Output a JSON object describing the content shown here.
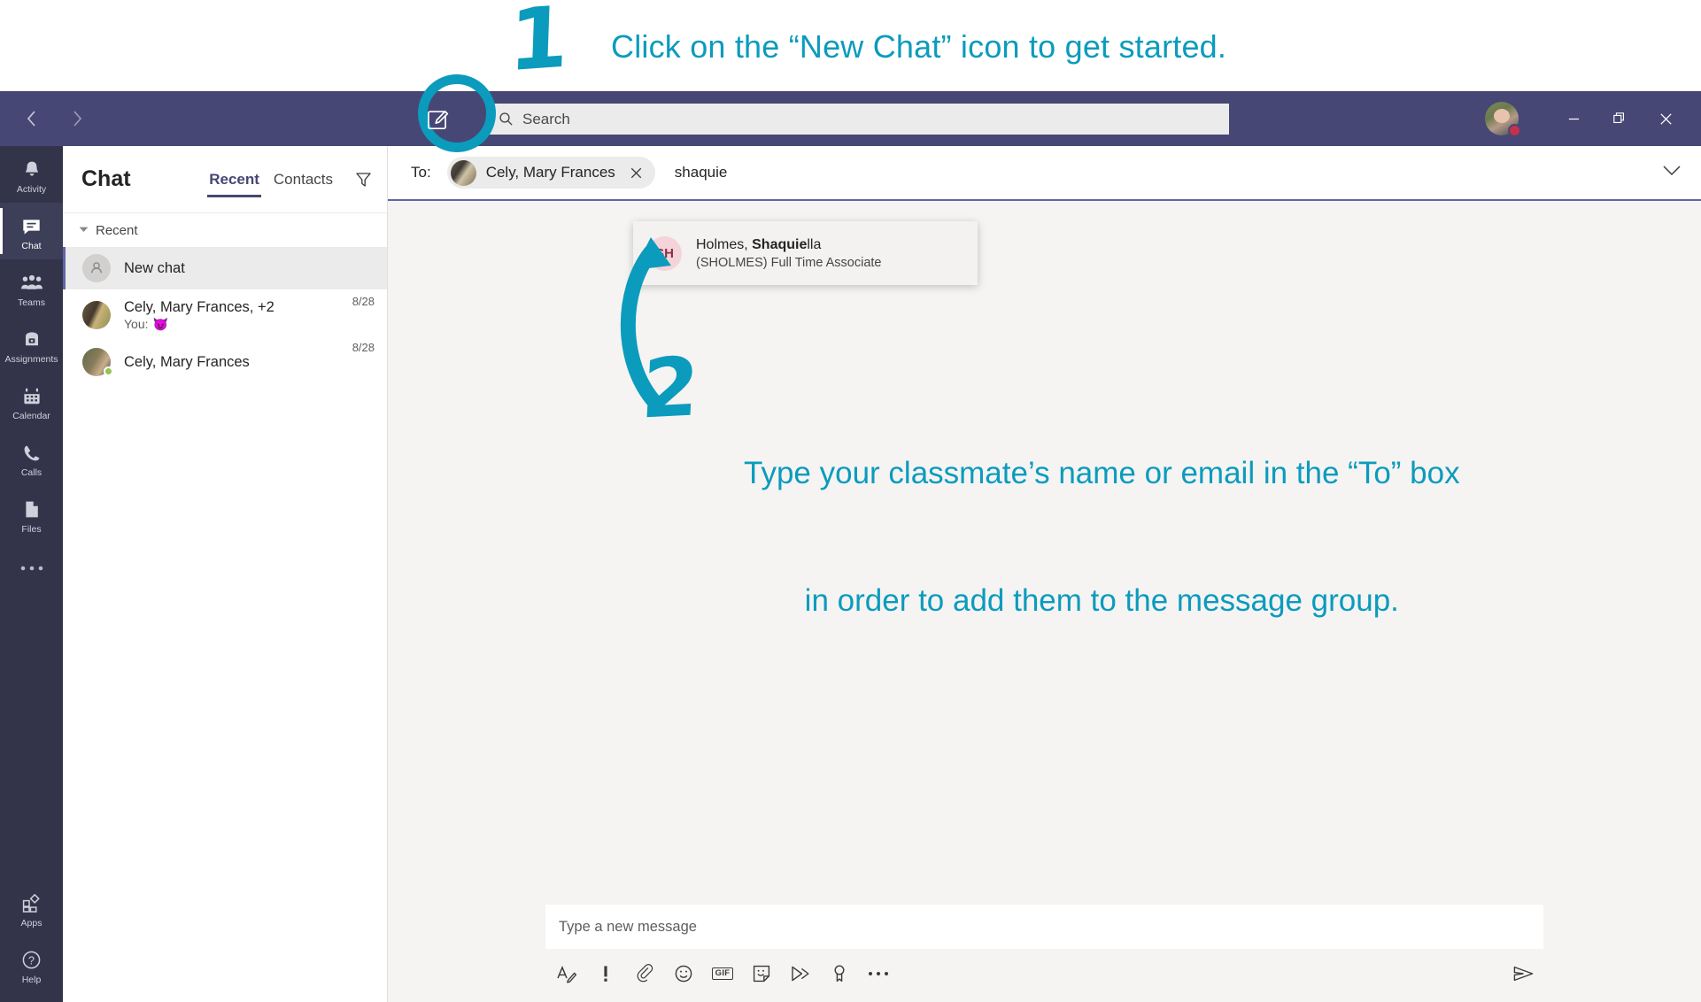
{
  "annotations": {
    "step1": {
      "numeral": "1",
      "text": "Click on the “New Chat” icon to get started."
    },
    "step2": {
      "numeral": "2",
      "line1": "Type your classmate’s name or email in the “To” box",
      "line2": "in order to add them to the message group."
    },
    "accent_color": "#0b9bbd"
  },
  "titlebar": {
    "back_icon": "chevron-left-icon",
    "forward_icon": "chevron-right-icon",
    "new_chat_icon": "compose-pencil-icon",
    "search_icon": "search-icon",
    "search_placeholder": "Search",
    "minimize_label": "—",
    "maximize_label": "❐",
    "close_label": "✕",
    "background_color": "#464775",
    "presence_color": "#c4314b"
  },
  "rail": {
    "items": [
      {
        "label": "Activity",
        "icon": "bell-icon",
        "active": false
      },
      {
        "label": "Chat",
        "icon": "chat-bubble-icon",
        "active": true
      },
      {
        "label": "Teams",
        "icon": "people-icon",
        "active": false
      },
      {
        "label": "Assignments",
        "icon": "backpack-icon",
        "active": false
      },
      {
        "label": "Calendar",
        "icon": "calendar-icon",
        "active": false
      },
      {
        "label": "Calls",
        "icon": "phone-icon",
        "active": false
      },
      {
        "label": "Files",
        "icon": "file-icon",
        "active": false
      },
      {
        "label": "",
        "icon": "more-dots-icon",
        "active": false
      }
    ],
    "bottom_items": [
      {
        "label": "Apps",
        "icon": "apps-icon"
      },
      {
        "label": "Help",
        "icon": "help-circle-icon"
      }
    ],
    "background_color": "#33344a"
  },
  "chat_panel": {
    "title": "Chat",
    "tabs": [
      {
        "label": "Recent",
        "active": true
      },
      {
        "label": "Contacts",
        "active": false
      }
    ],
    "filter_icon": "filter-funnel-icon",
    "group_label": "Recent",
    "group_chevron_icon": "chevron-down-icon",
    "rows": [
      {
        "name": "New chat",
        "preview": "",
        "date": "",
        "selected": true,
        "avatar": "placeholder-person-icon",
        "presence": ""
      },
      {
        "name": "Cely, Mary Frances, +2",
        "preview": "You:",
        "preview_emoji": "😈",
        "date": "8/28",
        "selected": false,
        "avatar": "group-photo",
        "presence": ""
      },
      {
        "name": "Cely, Mary Frances",
        "preview": "",
        "date": "8/28",
        "selected": false,
        "avatar": "person-photo",
        "presence": "available"
      }
    ],
    "accent_color": "#6264a7"
  },
  "to_bar": {
    "label": "To:",
    "chip": {
      "name": "Cely, Mary Frances",
      "close_icon": "close-icon"
    },
    "typed_text": "shaquie",
    "expand_icon": "chevron-down-icon"
  },
  "suggestions": [
    {
      "initials": "SH",
      "name_prefix": "Holmes, ",
      "name_match": "Shaquie",
      "name_suffix": "lla",
      "subtitle": "(SHOLMES) Full Time Associate"
    }
  ],
  "composer": {
    "placeholder": "Type a new message",
    "tools": [
      {
        "icon": "format-text-icon",
        "label": "Format"
      },
      {
        "icon": "priority-exclamation-icon",
        "label": "Set delivery options"
      },
      {
        "icon": "paperclip-attach-icon",
        "label": "Attach"
      },
      {
        "icon": "emoji-smiley-icon",
        "label": "Emoji"
      },
      {
        "icon": "gif-icon",
        "label": "GIF"
      },
      {
        "icon": "sticker-icon",
        "label": "Sticker"
      },
      {
        "icon": "stream-video-icon",
        "label": "Stream"
      },
      {
        "icon": "praise-badge-icon",
        "label": "Praise"
      },
      {
        "icon": "more-dots-icon",
        "label": "More options"
      }
    ],
    "send_icon": "send-paper-plane-icon"
  }
}
